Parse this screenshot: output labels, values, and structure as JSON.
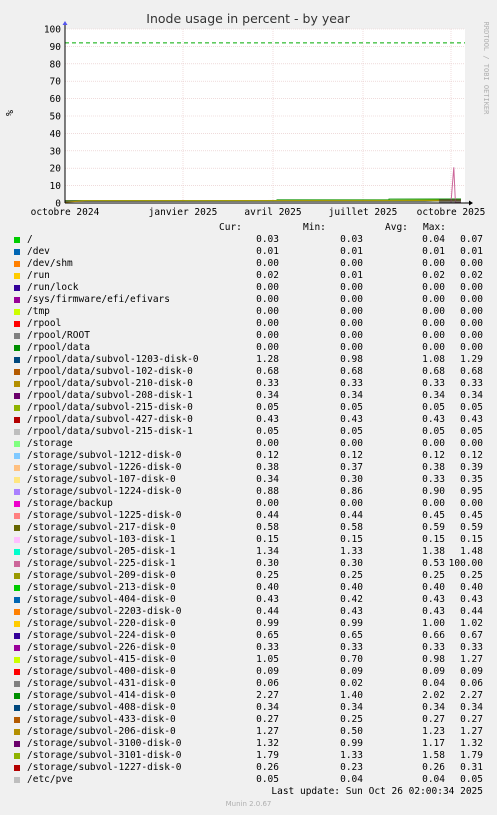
{
  "chart_data": {
    "type": "line",
    "title": "Inode usage in percent - by year",
    "ylabel": "%",
    "ylim": [
      0,
      100
    ],
    "yticks": [
      0,
      10,
      20,
      30,
      40,
      50,
      60,
      70,
      80,
      90,
      100
    ],
    "xticks": [
      "octobre 2024",
      "janvier 2025",
      "avril 2025",
      "juillet 2025",
      "octobre 2025"
    ],
    "warning_line": 92,
    "grid": true,
    "watermark": "RRDTOOL / TOBI OETIKER",
    "columns": [
      "Cur:",
      "Min:",
      "Avg:",
      "Max:"
    ],
    "series": [
      {
        "name": "/",
        "color": "#00cc00",
        "cur": "0.03",
        "min": "0.03",
        "avg": "0.04",
        "max": "0.07"
      },
      {
        "name": "/dev",
        "color": "#0066b3",
        "cur": "0.01",
        "min": "0.01",
        "avg": "0.01",
        "max": "0.01"
      },
      {
        "name": "/dev/shm",
        "color": "#ff8000",
        "cur": "0.00",
        "min": "0.00",
        "avg": "0.00",
        "max": "0.00"
      },
      {
        "name": "/run",
        "color": "#ffcc00",
        "cur": "0.02",
        "min": "0.01",
        "avg": "0.02",
        "max": "0.02"
      },
      {
        "name": "/run/lock",
        "color": "#330099",
        "cur": "0.00",
        "min": "0.00",
        "avg": "0.00",
        "max": "0.00"
      },
      {
        "name": "/sys/firmware/efi/efivars",
        "color": "#990099",
        "cur": "0.00",
        "min": "0.00",
        "avg": "0.00",
        "max": "0.00"
      },
      {
        "name": "/tmp",
        "color": "#ccff00",
        "cur": "0.00",
        "min": "0.00",
        "avg": "0.00",
        "max": "0.00"
      },
      {
        "name": "/rpool",
        "color": "#ff0000",
        "cur": "0.00",
        "min": "0.00",
        "avg": "0.00",
        "max": "0.00"
      },
      {
        "name": "/rpool/ROOT",
        "color": "#808080",
        "cur": "0.00",
        "min": "0.00",
        "avg": "0.00",
        "max": "0.00"
      },
      {
        "name": "/rpool/data",
        "color": "#008f00",
        "cur": "0.00",
        "min": "0.00",
        "avg": "0.00",
        "max": "0.00"
      },
      {
        "name": "/rpool/data/subvol-1203-disk-0",
        "color": "#00487d",
        "cur": "1.28",
        "min": "0.98",
        "avg": "1.08",
        "max": "1.29"
      },
      {
        "name": "/rpool/data/subvol-102-disk-0",
        "color": "#b35a00",
        "cur": "0.68",
        "min": "0.68",
        "avg": "0.68",
        "max": "0.68"
      },
      {
        "name": "/rpool/data/subvol-210-disk-0",
        "color": "#b38f00",
        "cur": "0.33",
        "min": "0.33",
        "avg": "0.33",
        "max": "0.33"
      },
      {
        "name": "/rpool/data/subvol-208-disk-1",
        "color": "#6b006b",
        "cur": "0.34",
        "min": "0.34",
        "avg": "0.34",
        "max": "0.34"
      },
      {
        "name": "/rpool/data/subvol-215-disk-0",
        "color": "#8fb300",
        "cur": "0.05",
        "min": "0.05",
        "avg": "0.05",
        "max": "0.05"
      },
      {
        "name": "/rpool/data/subvol-427-disk-0",
        "color": "#b30000",
        "cur": "0.43",
        "min": "0.43",
        "avg": "0.43",
        "max": "0.43"
      },
      {
        "name": "/rpool/data/subvol-215-disk-1",
        "color": "#bebebe",
        "cur": "0.05",
        "min": "0.05",
        "avg": "0.05",
        "max": "0.05"
      },
      {
        "name": "/storage",
        "color": "#80ff80",
        "cur": "0.00",
        "min": "0.00",
        "avg": "0.00",
        "max": "0.00"
      },
      {
        "name": "/storage/subvol-1212-disk-0",
        "color": "#80c9ff",
        "cur": "0.12",
        "min": "0.12",
        "avg": "0.12",
        "max": "0.12"
      },
      {
        "name": "/storage/subvol-1226-disk-0",
        "color": "#ffc080",
        "cur": "0.38",
        "min": "0.37",
        "avg": "0.38",
        "max": "0.39"
      },
      {
        "name": "/storage/subvol-107-disk-0",
        "color": "#ffe680",
        "cur": "0.34",
        "min": "0.30",
        "avg": "0.33",
        "max": "0.35"
      },
      {
        "name": "/storage/subvol-1224-disk-0",
        "color": "#aa80ff",
        "cur": "0.88",
        "min": "0.86",
        "avg": "0.90",
        "max": "0.95"
      },
      {
        "name": "/storage/backup",
        "color": "#ee00cc",
        "cur": "0.00",
        "min": "0.00",
        "avg": "0.00",
        "max": "0.00"
      },
      {
        "name": "/storage/subvol-1225-disk-0",
        "color": "#ff8080",
        "cur": "0.44",
        "min": "0.44",
        "avg": "0.45",
        "max": "0.45"
      },
      {
        "name": "/storage/subvol-217-disk-0",
        "color": "#666600",
        "cur": "0.58",
        "min": "0.58",
        "avg": "0.59",
        "max": "0.59"
      },
      {
        "name": "/storage/subvol-103-disk-1",
        "color": "#ffbfff",
        "cur": "0.15",
        "min": "0.15",
        "avg": "0.15",
        "max": "0.15"
      },
      {
        "name": "/storage/subvol-205-disk-1",
        "color": "#00ffcc",
        "cur": "1.34",
        "min": "1.33",
        "avg": "1.38",
        "max": "1.48"
      },
      {
        "name": "/storage/subvol-225-disk-1",
        "color": "#cc6699",
        "cur": "0.30",
        "min": "0.30",
        "avg": "0.53",
        "max": "100.00"
      },
      {
        "name": "/storage/subvol-209-disk-0",
        "color": "#999900",
        "cur": "0.25",
        "min": "0.25",
        "avg": "0.25",
        "max": "0.25"
      },
      {
        "name": "/storage/subvol-213-disk-0",
        "color": "#00cc00",
        "cur": "0.40",
        "min": "0.40",
        "avg": "0.40",
        "max": "0.40"
      },
      {
        "name": "/storage/subvol-404-disk-0",
        "color": "#0066b3",
        "cur": "0.43",
        "min": "0.42",
        "avg": "0.43",
        "max": "0.43"
      },
      {
        "name": "/storage/subvol-2203-disk-0",
        "color": "#ff8000",
        "cur": "0.44",
        "min": "0.43",
        "avg": "0.43",
        "max": "0.44"
      },
      {
        "name": "/storage/subvol-220-disk-0",
        "color": "#ffcc00",
        "cur": "0.99",
        "min": "0.99",
        "avg": "1.00",
        "max": "1.02"
      },
      {
        "name": "/storage/subvol-224-disk-0",
        "color": "#330099",
        "cur": "0.65",
        "min": "0.65",
        "avg": "0.66",
        "max": "0.67"
      },
      {
        "name": "/storage/subvol-226-disk-0",
        "color": "#990099",
        "cur": "0.33",
        "min": "0.33",
        "avg": "0.33",
        "max": "0.33"
      },
      {
        "name": "/storage/subvol-415-disk-0",
        "color": "#ccff00",
        "cur": "1.05",
        "min": "0.70",
        "avg": "0.98",
        "max": "1.27"
      },
      {
        "name": "/storage/subvol-400-disk-0",
        "color": "#ff0000",
        "cur": "0.09",
        "min": "0.09",
        "avg": "0.09",
        "max": "0.09"
      },
      {
        "name": "/storage/subvol-431-disk-0",
        "color": "#808080",
        "cur": "0.06",
        "min": "0.02",
        "avg": "0.04",
        "max": "0.06"
      },
      {
        "name": "/storage/subvol-414-disk-0",
        "color": "#008f00",
        "cur": "2.27",
        "min": "1.40",
        "avg": "2.02",
        "max": "2.27"
      },
      {
        "name": "/storage/subvol-408-disk-0",
        "color": "#00487d",
        "cur": "0.34",
        "min": "0.34",
        "avg": "0.34",
        "max": "0.34"
      },
      {
        "name": "/storage/subvol-433-disk-0",
        "color": "#b35a00",
        "cur": "0.27",
        "min": "0.25",
        "avg": "0.27",
        "max": "0.27"
      },
      {
        "name": "/storage/subvol-206-disk-0",
        "color": "#b38f00",
        "cur": "1.27",
        "min": "0.50",
        "avg": "1.23",
        "max": "1.27"
      },
      {
        "name": "/storage/subvol-3100-disk-0",
        "color": "#6b006b",
        "cur": "1.32",
        "min": "0.99",
        "avg": "1.17",
        "max": "1.32"
      },
      {
        "name": "/storage/subvol-3101-disk-0",
        "color": "#8fb300",
        "cur": "1.79",
        "min": "1.33",
        "avg": "1.58",
        "max": "1.79"
      },
      {
        "name": "/storage/subvol-1227-disk-0",
        "color": "#b30000",
        "cur": "0.26",
        "min": "0.23",
        "avg": "0.26",
        "max": "0.31"
      },
      {
        "name": "/etc/pve",
        "color": "#bebebe",
        "cur": "0.05",
        "min": "0.04",
        "avg": "0.04",
        "max": "0.05"
      }
    ]
  },
  "last_update": "Last update: Sun Oct 26 02:00:34 2025",
  "footer": "Munin 2.0.67"
}
